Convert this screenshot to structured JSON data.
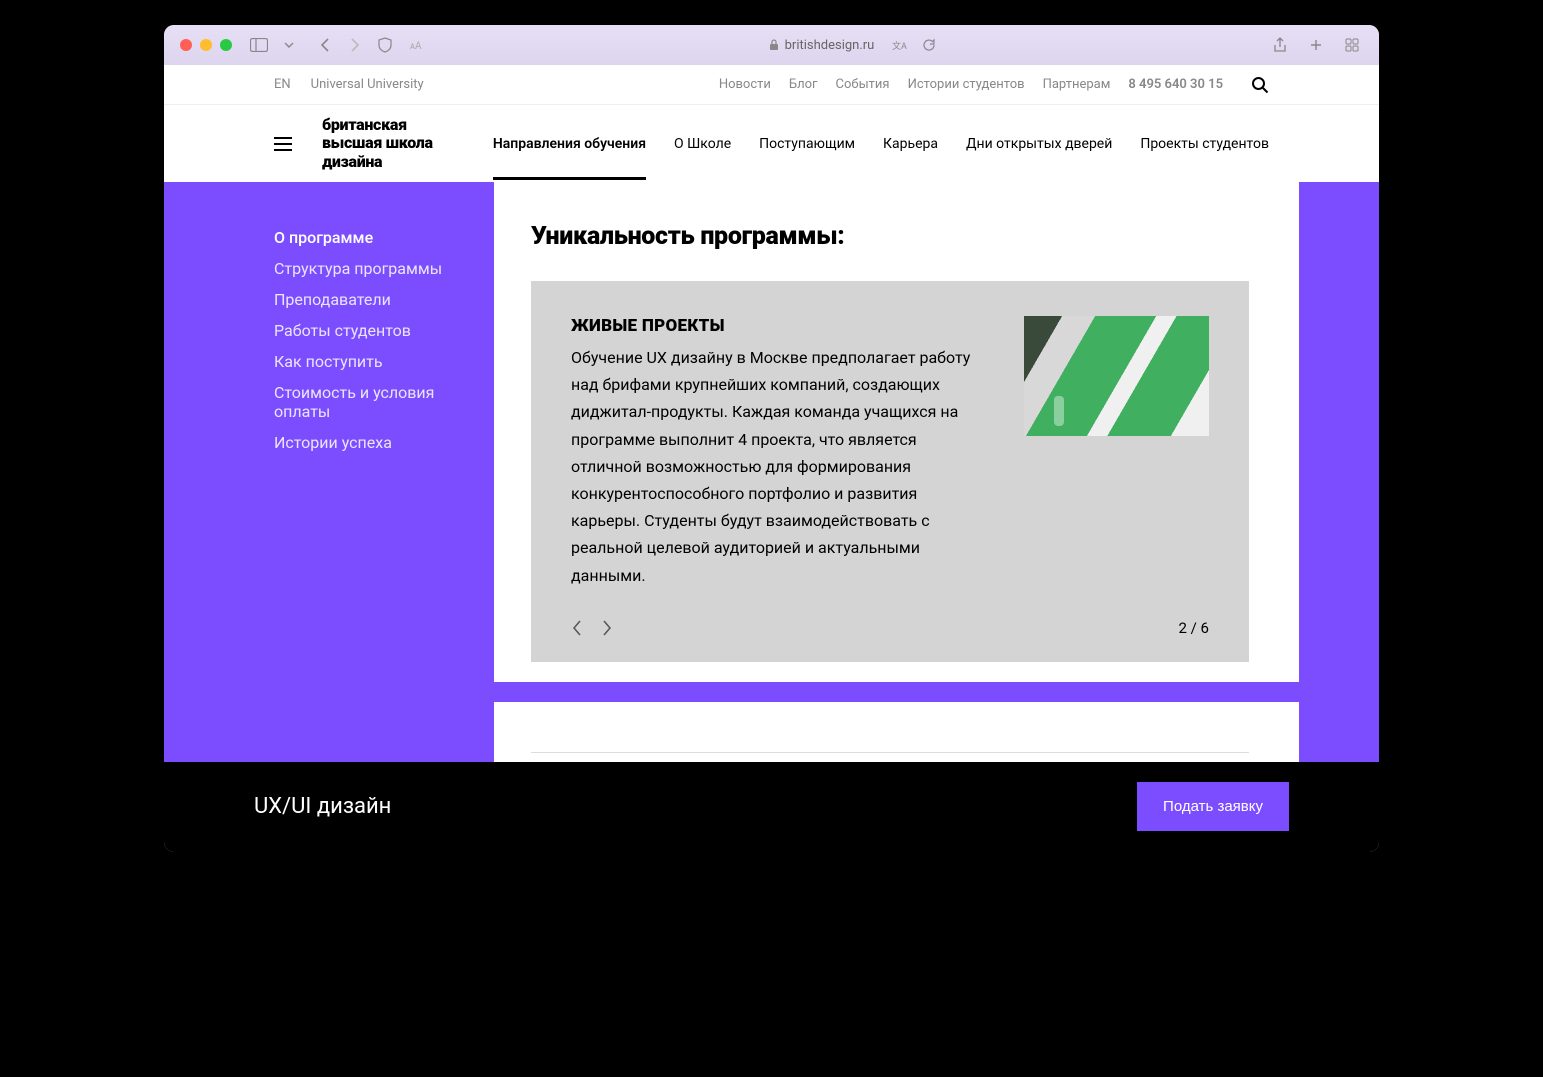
{
  "browser": {
    "url_host": "britishdesign.ru"
  },
  "topbar": {
    "lang": "EN",
    "brand": "Universal University",
    "links": [
      "Новости",
      "Блог",
      "События",
      "Истории студентов",
      "Партнерам"
    ],
    "phone": "8 495 640 30 15"
  },
  "logo": {
    "line1": "британская",
    "line2": "высшая школа",
    "line3": "дизайна"
  },
  "nav": {
    "items": [
      {
        "label": "Направления обучения",
        "active": true
      },
      {
        "label": "О Школе",
        "active": false
      },
      {
        "label": "Поступающим",
        "active": false
      },
      {
        "label": "Карьера",
        "active": false
      },
      {
        "label": "Дни открытых дверей",
        "active": false
      },
      {
        "label": "Проекты студентов",
        "active": false
      }
    ]
  },
  "sidemenu": {
    "items": [
      {
        "label": "О программе",
        "active": true
      },
      {
        "label": "Структура программы",
        "active": false
      },
      {
        "label": "Преподаватели",
        "active": false
      },
      {
        "label": "Работы студентов",
        "active": false
      },
      {
        "label": "Как поступить",
        "active": false
      },
      {
        "label": "Стоимость и условия оплаты",
        "active": false
      },
      {
        "label": "Истории успеха",
        "active": false
      }
    ]
  },
  "section": {
    "title": "Уникальность программы:"
  },
  "card": {
    "title": "ЖИВЫЕ ПРОЕКТЫ",
    "description": "Обучение UX дизайну в Москве предполагает работу над брифами крупнейших компаний, создающих диджитал-продукты. Каждая команда учащихся на программе выполнит 4 проекта, что является отличной возможностью для формирования конкурентоспособного портфолио и развития карьеры. Студенты будут взаимодействовать с реальной целевой аудиторией и актуальными данными.",
    "counter": "2 / 6"
  },
  "sticky": {
    "title": "UX/UI дизайн",
    "apply": "Подать заявку"
  }
}
